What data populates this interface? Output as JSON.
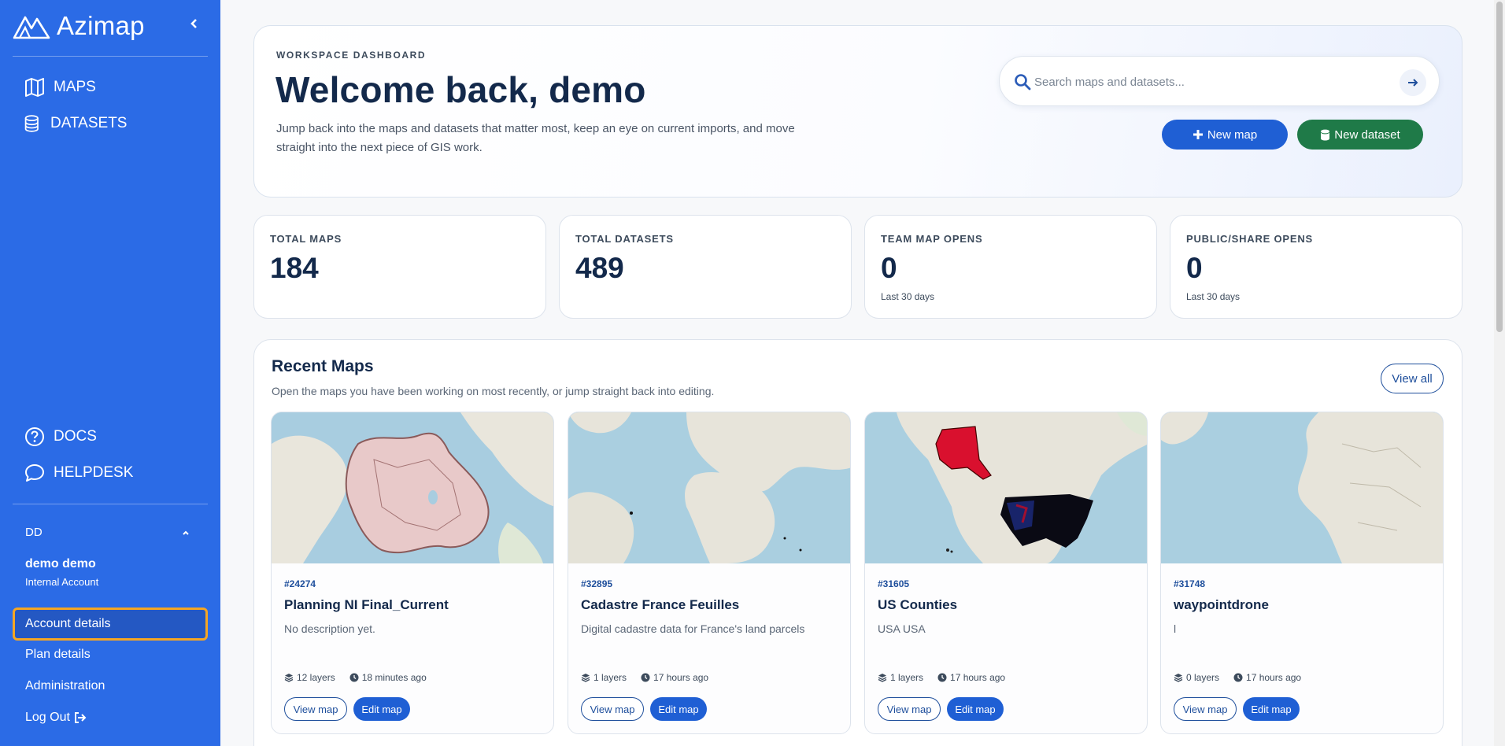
{
  "app": {
    "brand": "Azimap"
  },
  "sidebar": {
    "nav": [
      {
        "label": "MAPS",
        "icon": "map-icon"
      },
      {
        "label": "DATASETS",
        "icon": "database-icon"
      }
    ],
    "support": [
      {
        "label": "DOCS",
        "icon": "question-icon"
      },
      {
        "label": "HELPDESK",
        "icon": "chat-icon"
      }
    ],
    "account_initials": "DD",
    "user_name": "demo demo",
    "user_type": "Internal Account",
    "links": [
      {
        "label": "Account details",
        "active": true
      },
      {
        "label": "Plan details"
      },
      {
        "label": "Administration"
      },
      {
        "label": "Log Out"
      }
    ]
  },
  "hero": {
    "eyebrow": "WORKSPACE DASHBOARD",
    "title": "Welcome back, demo",
    "description": "Jump back into the maps and datasets that matter most, keep an eye on current imports, and move straight into the next piece of GIS work.",
    "search_placeholder": "Search maps and datasets...",
    "new_map_label": "New map",
    "new_dataset_label": "New dataset"
  },
  "stats": [
    {
      "label": "TOTAL MAPS",
      "value": "184",
      "sub": ""
    },
    {
      "label": "TOTAL DATASETS",
      "value": "489",
      "sub": ""
    },
    {
      "label": "TEAM MAP OPENS",
      "value": "0",
      "sub": "Last 30 days"
    },
    {
      "label": "PUBLIC/SHARE OPENS",
      "value": "0",
      "sub": "Last 30 days"
    }
  ],
  "recent": {
    "title": "Recent Maps",
    "subtitle": "Open the maps you have been working on most recently, or jump straight back into editing.",
    "view_all": "View all",
    "view_map_label": "View map",
    "edit_map_label": "Edit map",
    "cards": [
      {
        "id": "#24274",
        "title": "Planning NI Final_Current",
        "description": "No description yet.",
        "layers": "12 layers",
        "updated": "18 minutes ago"
      },
      {
        "id": "#32895",
        "title": "Cadastre France Feuilles",
        "description": "Digital cadastre data for France's land parcels",
        "layers": "1 layers",
        "updated": "17 hours ago"
      },
      {
        "id": "#31605",
        "title": "US Counties",
        "description": "USA USA",
        "layers": "1 layers",
        "updated": "17 hours ago"
      },
      {
        "id": "#31748",
        "title": "waypointdrone",
        "description": "l",
        "layers": "0 layers",
        "updated": "17 hours ago"
      }
    ]
  },
  "colors": {
    "sidebar": "#2b6be6",
    "accent_blue": "#1f5fd4",
    "accent_green": "#1f7a48",
    "active_outline": "#f5a623",
    "heading": "#13294b"
  }
}
